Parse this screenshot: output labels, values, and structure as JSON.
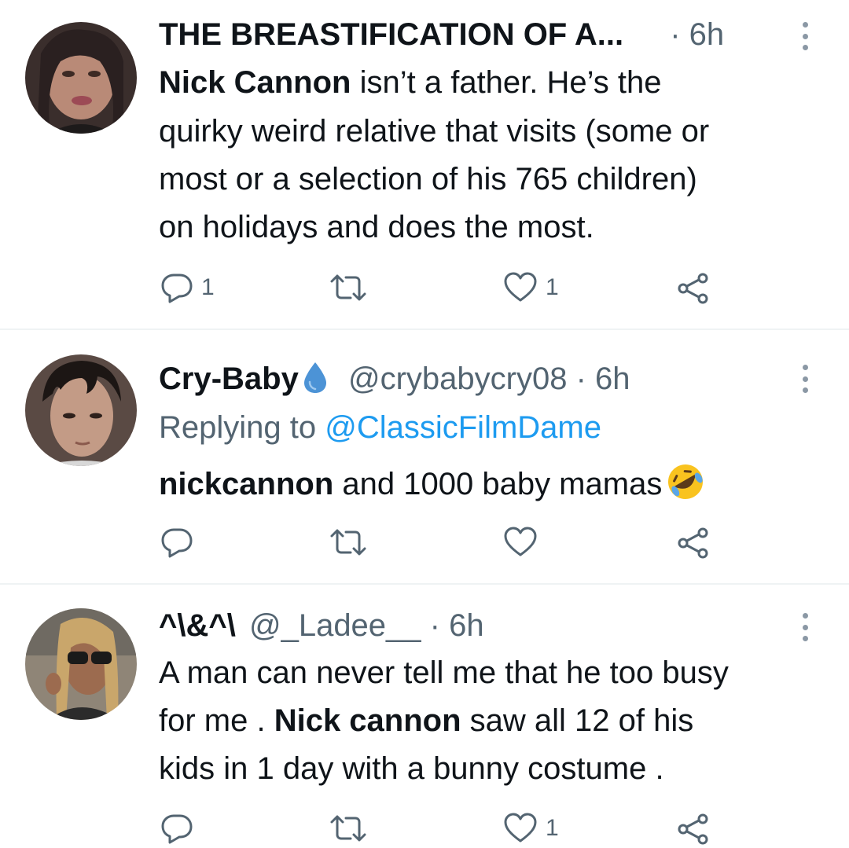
{
  "tweets": [
    {
      "display_name": "THE BREASTIFICATION OF A...",
      "handle": "",
      "sep": "·",
      "time": "6h",
      "lines": [
        {
          "bold": "Nick Cannon",
          "rest": " isn’t a father. He’s the"
        },
        {
          "bold": "",
          "rest": "quirky weird relative that visits (some or"
        },
        {
          "bold": "",
          "rest": "most or a selection of his 765 children)"
        },
        {
          "bold": "",
          "rest": "on holidays and does the most."
        }
      ],
      "reply_count": "1",
      "retweet_count": "",
      "like_count": "1"
    },
    {
      "display_name": "Cry-Baby",
      "verified_icon": "water-drop-icon",
      "handle": "@crybabycry08",
      "sep": "·",
      "time": "6h",
      "replying_prefix": "Replying to ",
      "replying_to": "@ClassicFilmDame",
      "lines": [
        {
          "bold": "nickcannon",
          "rest": " and 1000 baby mamas"
        }
      ],
      "emoji": "rolling-on-floor-laughing-emoji",
      "reply_count": "",
      "retweet_count": "",
      "like_count": ""
    },
    {
      "display_name": "^\\&^\\",
      "handle": "@_Ladee__",
      "sep": "·",
      "time": "6h",
      "lines": [
        {
          "bold": "",
          "rest": "A man can never tell me that he too busy"
        },
        {
          "pre": "for me . ",
          "bold": "Nick cannon",
          "rest": " saw all 12 of his"
        },
        {
          "bold": "",
          "rest": "kids in 1 day with a bunny costume ."
        }
      ],
      "reply_count": "",
      "retweet_count": "",
      "like_count": "1"
    }
  ],
  "icons": {
    "reply": "reply-icon",
    "retweet": "retweet-icon",
    "like": "heart-icon",
    "share": "share-icon",
    "more": "more-vertical-icon"
  },
  "colors": {
    "text": "#0f1419",
    "muted": "#536471",
    "link": "#1d9bf0",
    "icon": "#536471",
    "divider": "#eff3f4"
  }
}
